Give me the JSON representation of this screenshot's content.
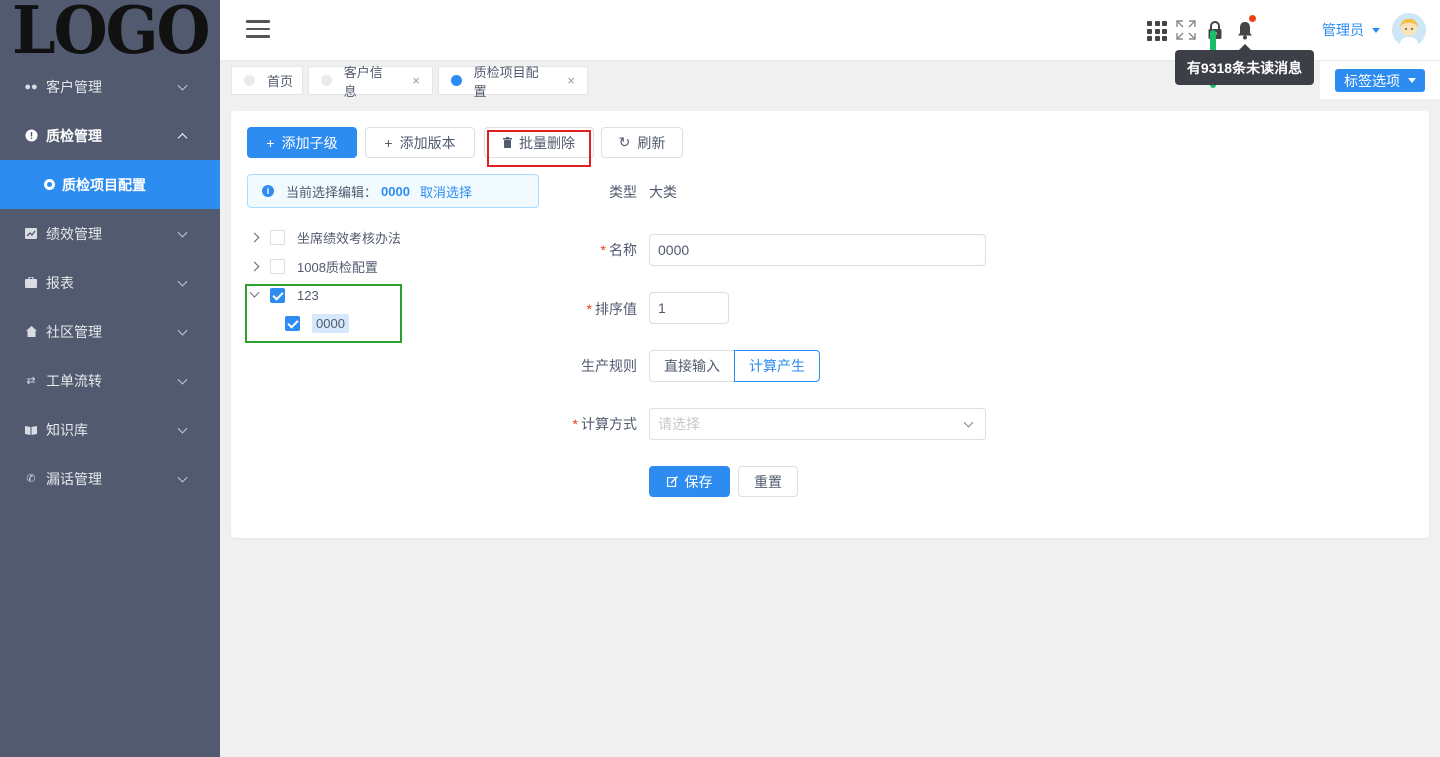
{
  "logo": "LOGO",
  "sidebar": {
    "items": [
      {
        "label": "客户管理",
        "icon": "users-icon"
      },
      {
        "label": "质检管理",
        "icon": "info-circle-icon"
      },
      {
        "label": "绩效管理",
        "icon": "chart-icon"
      },
      {
        "label": "报表",
        "icon": "briefcase-icon"
      },
      {
        "label": "社区管理",
        "icon": "home-icon"
      },
      {
        "label": "工单流转",
        "icon": "transfer-icon"
      },
      {
        "label": "知识库",
        "icon": "book-icon"
      },
      {
        "label": "漏话管理",
        "icon": "phone-icon"
      }
    ],
    "sub_item": "质检项目配置"
  },
  "header": {
    "user": "管理员",
    "tooltip": "有9318条未读消息"
  },
  "tabs": [
    {
      "label": "首页"
    },
    {
      "label": "客户信息",
      "close": "×"
    },
    {
      "label": "质检项目配置",
      "close": "×"
    }
  ],
  "tag_options": "标签选项",
  "toolbar": {
    "add_child": "添加子级",
    "add_version": "添加版本",
    "batch_delete": "批量删除",
    "refresh": "刷新"
  },
  "alert": {
    "prefix": "当前选择编辑：",
    "code": "0000",
    "cancel": "取消选择"
  },
  "tree": {
    "nodes": [
      {
        "label": "坐席绩效考核办法",
        "checked": false
      },
      {
        "label": "1008质检配置",
        "checked": false
      },
      {
        "label": "123",
        "checked": true,
        "expanded": true
      },
      {
        "label": "0000",
        "checked": true,
        "selected": true
      }
    ]
  },
  "form": {
    "type_label": "类型",
    "type_value": "大类",
    "name_label": "名称",
    "name_value": "0000",
    "sort_label": "排序值",
    "sort_value": "1",
    "rule_label": "生产规则",
    "rule_options": [
      "直接输入",
      "计算产生"
    ],
    "rule_selected": "计算产生",
    "calc_label": "计算方式",
    "calc_placeholder": "请选择",
    "save": "保存",
    "reset": "重置"
  },
  "colors": {
    "primary": "#2d8cf0",
    "sidebar": "#515a6e",
    "required": "#ed4014"
  }
}
